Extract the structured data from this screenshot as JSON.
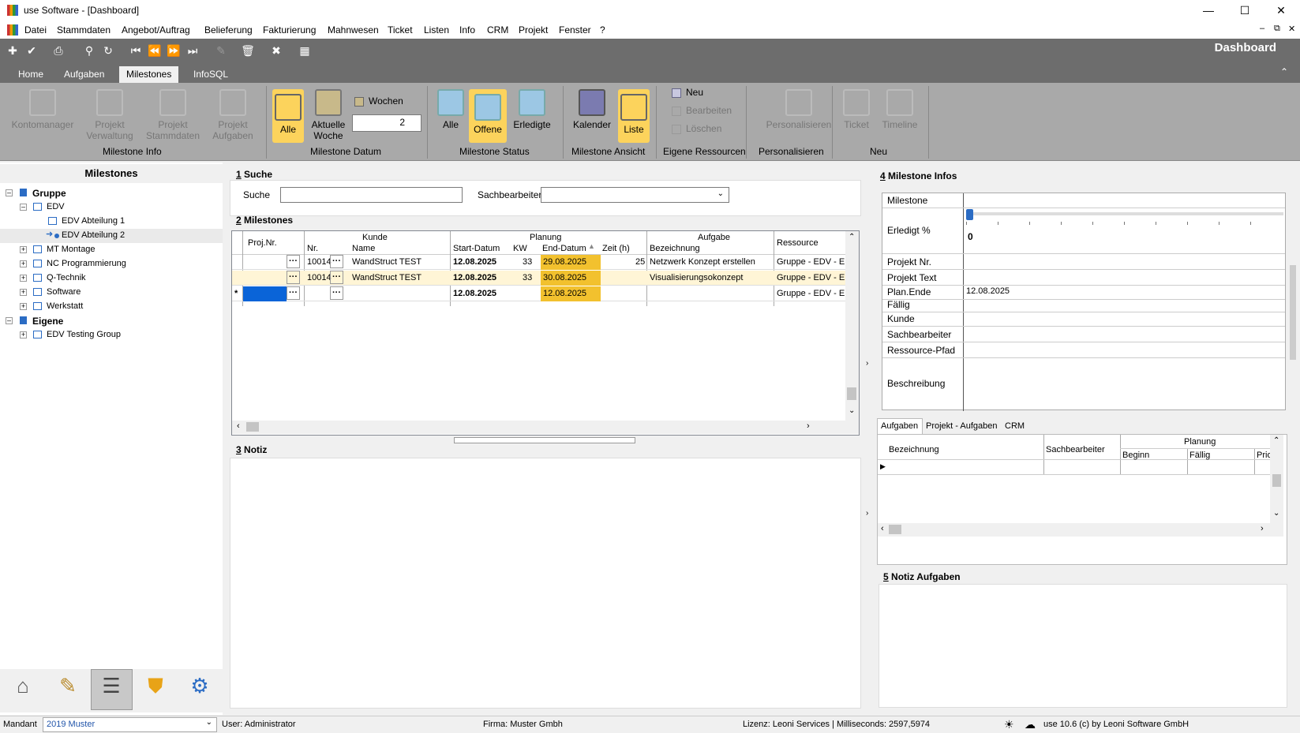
{
  "window": {
    "title": "use Software - [Dashboard]"
  },
  "menu": [
    "Datei",
    "Stammdaten",
    "Angebot/Auftrag",
    "Belieferung",
    "Fakturierung",
    "Mahnwesen",
    "Ticket",
    "Listen",
    "Info",
    "CRM",
    "Projekt",
    "Fenster",
    "?"
  ],
  "dashboard_label": "Dashboard",
  "ribbon_tabs": [
    "Home",
    "Aufgaben",
    "Milestones",
    "InfoSQL"
  ],
  "ribbon": {
    "kontomanager": "Kontomanager",
    "projekt_verwaltung": [
      "Projekt",
      "Verwaltung"
    ],
    "projekt_stammdaten": [
      "Projekt",
      "Stammdaten"
    ],
    "projekt_aufgaben": [
      "Projekt",
      "Aufgaben"
    ],
    "group_info": "Milestone Info",
    "alle": "Alle",
    "aktuelle_woche": [
      "Aktuelle",
      "Woche"
    ],
    "wochen": "Wochen",
    "wochen_value": "2",
    "group_datum": "Milestone Datum",
    "status_alle": "Alle",
    "offene": "Offene",
    "erledigte": "Erledigte",
    "group_status": "Milestone Status",
    "kalender": "Kalender",
    "liste": "Liste",
    "group_ansicht": "Milestone Ansicht",
    "neu": "Neu",
    "bearbeiten": "Bearbeiten",
    "loeschen": "Löschen",
    "group_ressourcen": "Eigene Ressourcen",
    "personalisieren": "Personalisieren",
    "group_personalisieren": "Personalisieren",
    "ticket": "Ticket",
    "timeline": "Timeline",
    "group_neu": "Neu"
  },
  "left": {
    "header": "Milestones",
    "tree": {
      "gruppe": "Gruppe",
      "edv": "EDV",
      "edv1": "EDV Abteilung 1",
      "edv2": "EDV Abteilung 2",
      "mt": "MT Montage",
      "nc": "NC Programmierung",
      "qt": "Q-Technik",
      "sw": "Software",
      "ws": "Werkstatt",
      "eigene": "Eigene",
      "edvtest": "EDV Testing Group"
    }
  },
  "search": {
    "num": "1",
    "title": "Suche",
    "suche_label": "Suche",
    "sachbearbeiter_label": "Sachbearbeiter"
  },
  "milestones": {
    "num": "2",
    "title": "Milestones",
    "headers": {
      "projnr": "Proj.Nr.",
      "kunde": "Kunde",
      "nr": "Nr.",
      "name": "Name",
      "planung": "Planung",
      "start": "Start-Datum",
      "kw": "KW",
      "end": "End-Datum",
      "zeit": "Zeit (h)",
      "aufgabe": "Aufgabe",
      "bez": "Bezeichnung",
      "ressource": "Ressource"
    },
    "rows": [
      {
        "nr": "10014",
        "name": "WandStruct TEST",
        "start": "12.08.2025",
        "kw": "33",
        "end": "29.08.2025",
        "zeit": "25",
        "bez": "Netzwerk Konzept erstellen",
        "res": "Gruppe - EDV - ED"
      },
      {
        "nr": "10014",
        "name": "WandStruct TEST",
        "start": "12.08.2025",
        "kw": "33",
        "end": "30.08.2025",
        "zeit": "",
        "bez": "Visualisierungsokonzept",
        "res": "Gruppe - EDV - ED"
      },
      {
        "nr": "",
        "name": "",
        "start": "12.08.2025",
        "kw": "",
        "end": "12.08.2025",
        "zeit": "",
        "bez": "",
        "res": "Gruppe - EDV - ED"
      }
    ],
    "new_row_marker": "*"
  },
  "notiz": {
    "num": "3",
    "title": "Notiz"
  },
  "infos": {
    "num": "4",
    "title": "Milestone Infos",
    "milestone": "Milestone",
    "erledigt": "Erledigt %",
    "erledigt_value": "0",
    "projekt_nr": "Projekt Nr.",
    "projekt_text": "Projekt Text",
    "plan_ende": "Plan.Ende",
    "plan_ende_value": "12.08.2025",
    "faellig": "Fällig",
    "kunde": "Kunde",
    "sachbearbeiter": "Sachbearbeiter",
    "ressource_pfad": "Ressource-Pfad",
    "beschreibung": "Beschreibung"
  },
  "subtabs": [
    "Aufgaben",
    "Projekt - Aufgaben",
    "CRM"
  ],
  "subgrid": {
    "bez": "Bezeichnung",
    "sach": "Sachbearbeiter",
    "planung": "Planung",
    "beginn": "Beginn",
    "faellig": "Fällig",
    "prio": "Prio"
  },
  "notiz_aufgaben": {
    "num": "5",
    "title": "Notiz Aufgaben"
  },
  "status": {
    "mandant_label": "Mandant",
    "mandant_value": "2019 Muster",
    "user": "User: Administrator",
    "firma": "Firma: Muster Gmbh",
    "lizenz": "Lizenz: Leoni Services | Milliseconds: 2597,5974",
    "version": "use 10.6 (c) by Leoni Software GmbH"
  }
}
